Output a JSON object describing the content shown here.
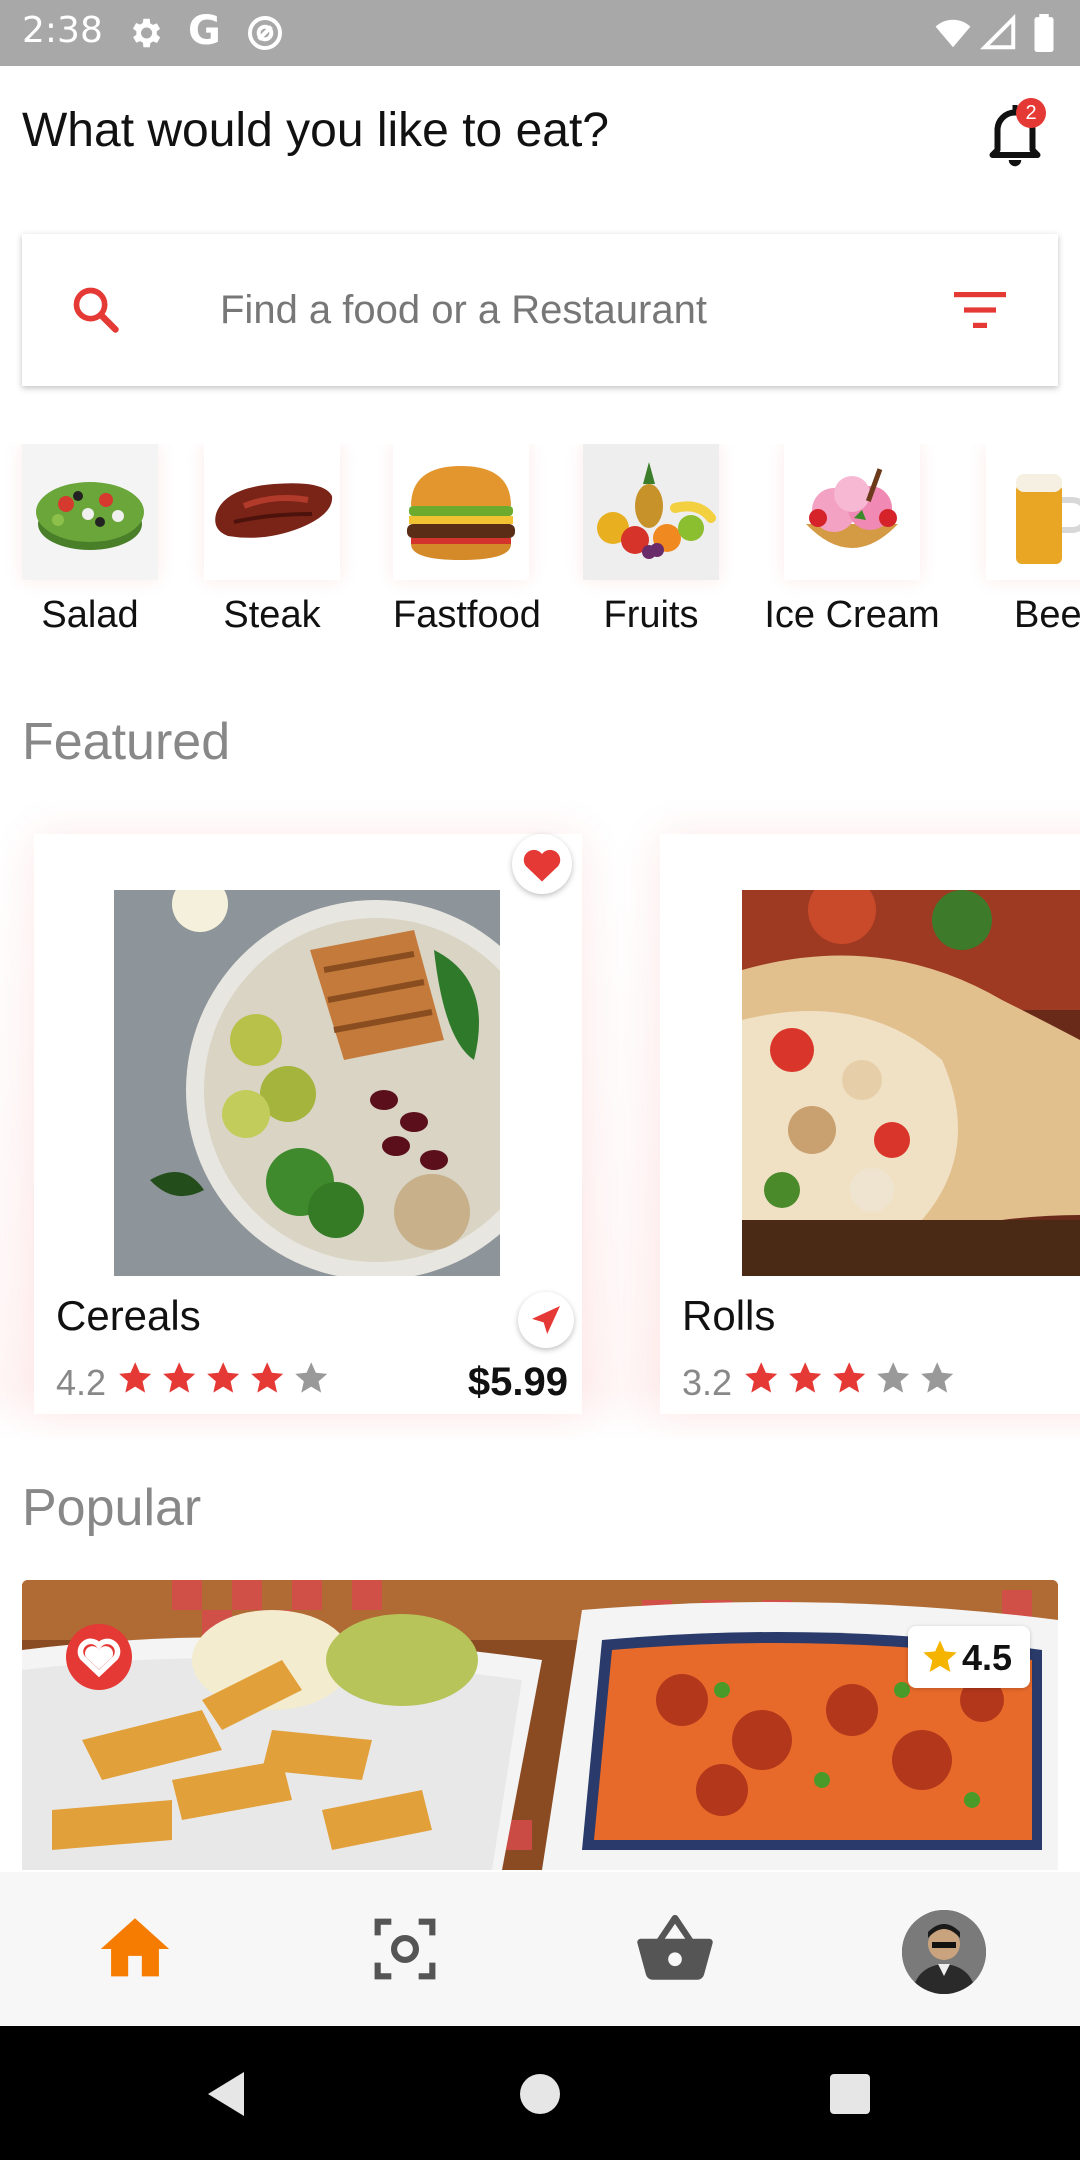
{
  "status_bar": {
    "time": "2:38",
    "letter": "G"
  },
  "header": {
    "title": "What would you like to eat?",
    "notification_count": "2"
  },
  "search": {
    "placeholder": "Find a food or a Restaurant"
  },
  "categories": [
    {
      "label": "Salad"
    },
    {
      "label": "Steak"
    },
    {
      "label": "Fastfood"
    },
    {
      "label": "Fruits"
    },
    {
      "label": "Ice Cream"
    },
    {
      "label": "Bee"
    }
  ],
  "featured": {
    "title": "Featured",
    "cards": [
      {
        "name": "Cereals",
        "rating": "4.2",
        "stars": 4,
        "price": "$5.99"
      },
      {
        "name": "Rolls",
        "rating": "3.2",
        "stars": 3,
        "price": ""
      }
    ]
  },
  "popular": {
    "title": "Popular",
    "rating": "4.5"
  },
  "colors": {
    "accent": "#e53935",
    "nav_active": "#f57c00",
    "star_empty": "#999999",
    "star_gold": "#f5b400"
  },
  "bottom_nav": {
    "items": [
      "home-icon",
      "scan-icon",
      "basket-icon",
      "avatar"
    ]
  }
}
